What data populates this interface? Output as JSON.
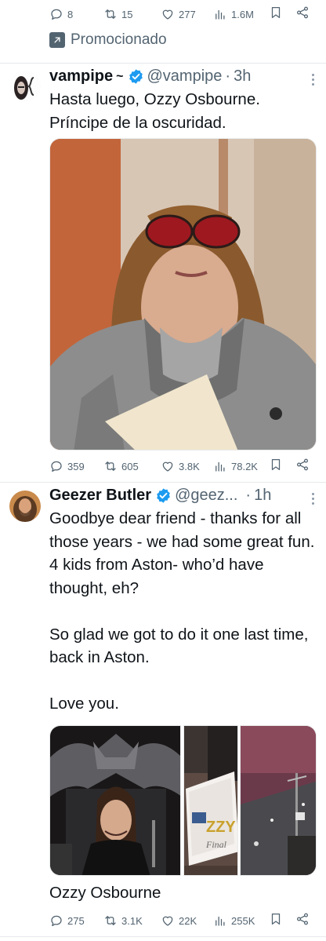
{
  "top_actions": {
    "replies": "8",
    "reposts": "15",
    "likes": "277",
    "views": "1.6M"
  },
  "promoted": {
    "label": "Promocionado"
  },
  "tweets": [
    {
      "name": "vampipe",
      "name_suffix": "~",
      "handle": "@vampipe",
      "time": "3h",
      "text": "Hasta luego, Ozzy Osbourne.\nPríncipe de la oscuridad.",
      "actions": {
        "replies": "359",
        "reposts": "605",
        "likes": "3.8K",
        "views": "78.2K"
      }
    },
    {
      "name": "Geezer Butler",
      "handle": "@geez...",
      "time": "1h",
      "text": "Goodbye dear friend - thanks for all those years - we had some great fun. 4 kids from Aston- who’d have thought, eh?\n\nSo glad we got to do it one last time, back in Aston.\n\nLove you.",
      "media_caption": "Ozzy Osbourne",
      "media_texts": [
        "ZZY",
        "Final"
      ],
      "actions": {
        "replies": "275",
        "reposts": "3.1K",
        "likes": "22K",
        "views": "255K"
      }
    }
  ],
  "colors": {
    "text": "#0f1419",
    "secondary": "#536471",
    "verified": "#1d9bf0",
    "divider": "#e7e9ea"
  }
}
